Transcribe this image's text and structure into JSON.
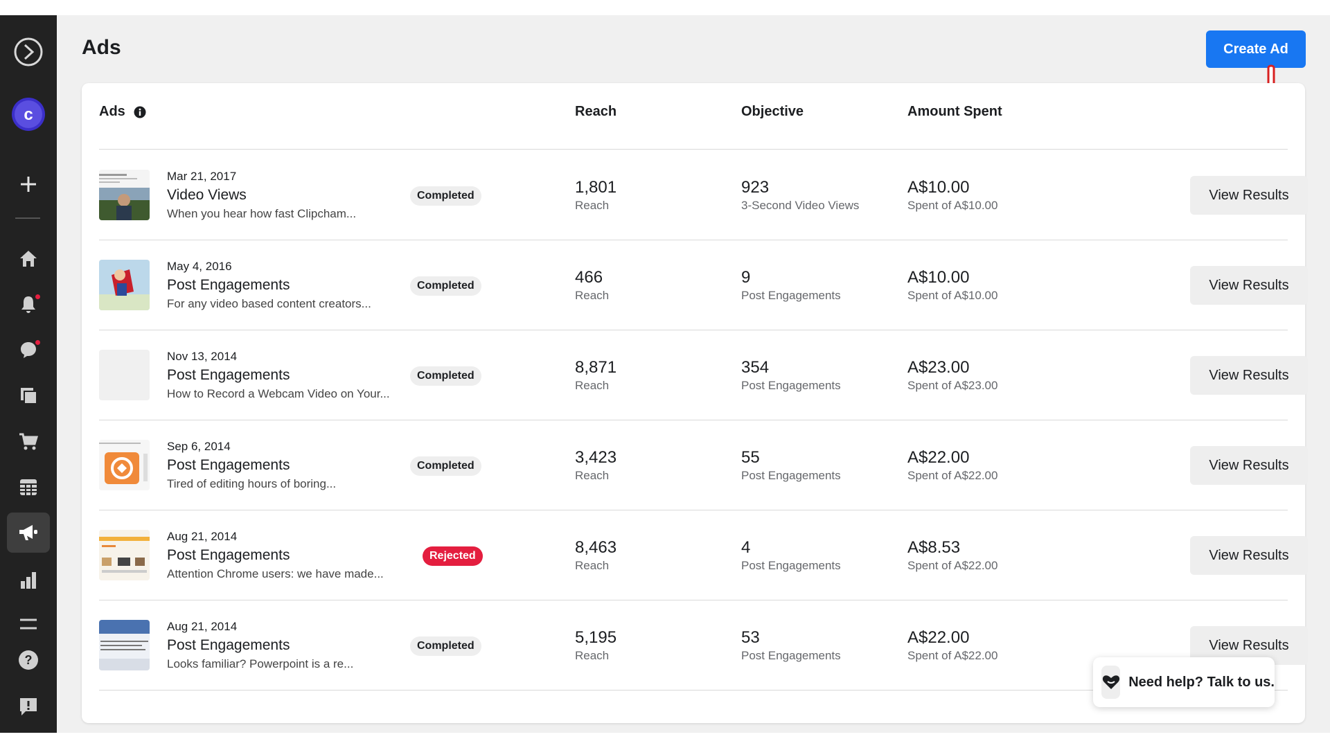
{
  "page": {
    "title": "Ads"
  },
  "toolbar": {
    "create_label": "Create Ad"
  },
  "table": {
    "headers": {
      "ads": "Ads",
      "reach": "Reach",
      "objective": "Objective",
      "amount": "Amount Spent"
    },
    "rows": [
      {
        "date": "Mar 21, 2017",
        "name": "Video Views",
        "desc": "When you hear how fast Clipcham...",
        "status": "Completed",
        "reach": "1,801",
        "reach_label": "Reach",
        "objective_value": "923",
        "objective_label": "3-Second Video Views",
        "amount": "A$10.00",
        "amount_sub": "Spent of A$10.00",
        "action": "View Results"
      },
      {
        "date": "May 4, 2016",
        "name": "Post Engagements",
        "desc": "For any video based content creators...",
        "status": "Completed",
        "reach": "466",
        "reach_label": "Reach",
        "objective_value": "9",
        "objective_label": "Post Engagements",
        "amount": "A$10.00",
        "amount_sub": "Spent of A$10.00",
        "action": "View Results"
      },
      {
        "date": "Nov 13, 2014",
        "name": "Post Engagements",
        "desc": "How to Record a Webcam Video on Your...",
        "status": "Completed",
        "reach": "8,871",
        "reach_label": "Reach",
        "objective_value": "354",
        "objective_label": "Post Engagements",
        "amount": "A$23.00",
        "amount_sub": "Spent of A$23.00",
        "action": "View Results"
      },
      {
        "date": "Sep 6, 2014",
        "name": "Post Engagements",
        "desc": "Tired of editing hours of boring...",
        "status": "Completed",
        "reach": "3,423",
        "reach_label": "Reach",
        "objective_value": "55",
        "objective_label": "Post Engagements",
        "amount": "A$22.00",
        "amount_sub": "Spent of A$22.00",
        "action": "View Results"
      },
      {
        "date": "Aug 21, 2014",
        "name": "Post Engagements",
        "desc": "Attention Chrome users: we have made...",
        "status": "Rejected",
        "reach": "8,463",
        "reach_label": "Reach",
        "objective_value": "4",
        "objective_label": "Post Engagements",
        "amount": "A$8.53",
        "amount_sub": "Spent of A$22.00",
        "action": "View Results"
      },
      {
        "date": "Aug 21, 2014",
        "name": "Post Engagements",
        "desc": "Looks familiar? Powerpoint is a re...",
        "status": "Completed",
        "reach": "5,195",
        "reach_label": "Reach",
        "objective_value": "53",
        "objective_label": "Post Engagements",
        "amount": "A$22.00",
        "amount_sub": "Spent of A$22.00",
        "action": "View Results"
      }
    ]
  },
  "help": {
    "label": "Need help? Talk to us."
  },
  "sidebar": {
    "icons": [
      "logo-icon",
      "account-avatar-icon",
      "plus-icon",
      "home-icon",
      "notifications-icon",
      "messages-icon",
      "pages-icon",
      "shop-icon",
      "calendar-icon",
      "ads-icon",
      "insights-icon",
      "menu-icon",
      "help-icon",
      "feedback-icon"
    ]
  },
  "colors": {
    "accent": "#1877f2",
    "sidebar": "#222222",
    "rejected": "#e41e3f",
    "avatar": "#3b2fc9"
  }
}
